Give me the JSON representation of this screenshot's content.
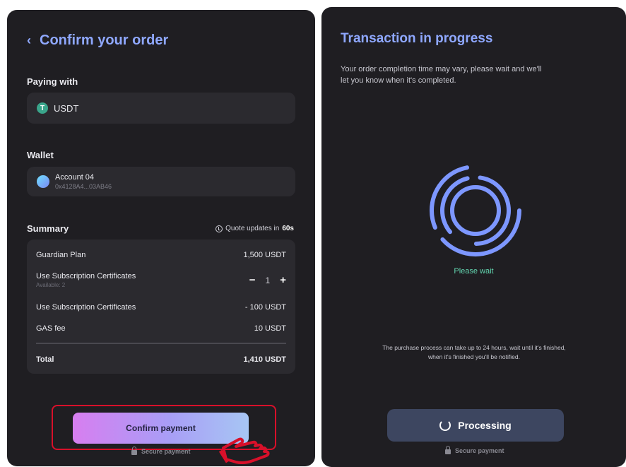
{
  "confirm_screen": {
    "title": "Confirm your order",
    "paying_label": "Paying with",
    "currency": "USDT",
    "currency_logo_letter": "T",
    "wallet_label": "Wallet",
    "wallet_name": "Account 04",
    "wallet_address": "0x4128A4...03AB46",
    "summary_label": "Summary",
    "quote_prefix": "Quote updates in",
    "quote_seconds": "60s",
    "rows": {
      "plan_label": "Guardian Plan",
      "plan_value": "1,500 USDT",
      "certs_label": "Use Subscription Certificates",
      "certs_available": "Available: 2",
      "certs_qty": "1",
      "minus": "−",
      "plus": "+",
      "certs_discount_label": "Use Subscription Certificates",
      "certs_discount_value": "- 100 USDT",
      "gas_label": "GAS fee",
      "gas_value": "10 USDT",
      "total_label": "Total",
      "total_value": "1,410 USDT"
    },
    "confirm_button": "Confirm payment",
    "secure": "Secure payment"
  },
  "progress_screen": {
    "title": "Transaction in progress",
    "description": "Your order completion time may vary, please wait and we'll let you know when it's completed.",
    "status": "Please wait",
    "note": "The purchase process can take up to 24 hours, wait until it's finished, when it's finished you'll be notified.",
    "processing_button": "Processing",
    "secure": "Secure payment"
  },
  "colors": {
    "accent": "#8fa8ff",
    "panel_bg": "#1f1e22",
    "card_bg": "#2b2a2f",
    "status_green": "#63d6b0",
    "highlight_red": "#d8102a"
  },
  "icons": [
    "back-chevron-icon",
    "usdt-logo-icon",
    "wallet-avatar-icon",
    "clock-icon",
    "lock-icon",
    "pointing-hand-icon",
    "spinner-rings-icon",
    "loading-icon"
  ]
}
